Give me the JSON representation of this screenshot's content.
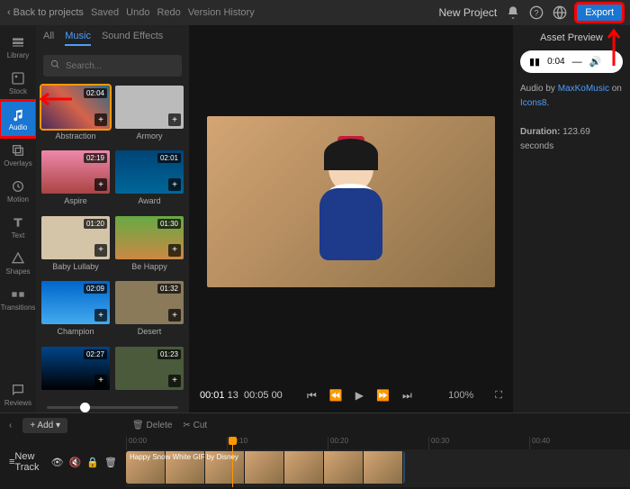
{
  "topbar": {
    "back": "Back to projects",
    "saved": "Saved",
    "undo": "Undo",
    "redo": "Redo",
    "history": "Version History",
    "title": "New Project",
    "export": "Export"
  },
  "sidebar": [
    {
      "id": "library",
      "label": "Library"
    },
    {
      "id": "stock",
      "label": "Stock"
    },
    {
      "id": "audio",
      "label": "Audio"
    },
    {
      "id": "overlays",
      "label": "Overlays"
    },
    {
      "id": "motion",
      "label": "Motion"
    },
    {
      "id": "text",
      "label": "Text"
    },
    {
      "id": "shapes",
      "label": "Shapes"
    },
    {
      "id": "transitions",
      "label": "Transitions"
    },
    {
      "id": "reviews",
      "label": "Reviews"
    }
  ],
  "tabs": {
    "all": "All",
    "music": "Music",
    "sfx": "Sound Effects"
  },
  "search": {
    "placeholder": "Search..."
  },
  "clips": [
    {
      "name": "Abstraction",
      "dur": "02:04",
      "bg": "linear-gradient(45deg,#4a2c5a,#d4634a,#2a6a8a)"
    },
    {
      "name": "Armory",
      "dur": "",
      "bg": "#bbb"
    },
    {
      "name": "Aspire",
      "dur": "02:19",
      "bg": "linear-gradient(#e8a,#a44)"
    },
    {
      "name": "Award",
      "dur": "02:01",
      "bg": "linear-gradient(#047,#069)"
    },
    {
      "name": "Baby Lullaby",
      "dur": "01:20",
      "bg": "#d4c4a8"
    },
    {
      "name": "Be Happy",
      "dur": "01:30",
      "bg": "linear-gradient(#6a4,#c84)"
    },
    {
      "name": "Champion",
      "dur": "02:09",
      "bg": "linear-gradient(#06c,#4ae)"
    },
    {
      "name": "Desert",
      "dur": "01:32",
      "bg": "#8a7a5a"
    },
    {
      "name": "",
      "dur": "02:27",
      "bg": "linear-gradient(#048,#000)"
    },
    {
      "name": "",
      "dur": "01:23",
      "bg": "#4a5a3a"
    }
  ],
  "player": {
    "cur": "00:01",
    "frames": "13",
    "total": "00:05",
    "tf": "00",
    "zoom": "100%"
  },
  "asset": {
    "title": "Asset Preview",
    "time": "0:04",
    "credit_prefix": "Audio by ",
    "author": "MaxKoMusic",
    "on": " on ",
    "site": "Icons8",
    "dur_label": "Duration: ",
    "dur": "123.69 seconds"
  },
  "timeline": {
    "add": "Add",
    "delete": "Delete",
    "cut": "Cut",
    "marks": [
      "00:00",
      "00:10",
      "00:20",
      "00:30",
      "00:40"
    ],
    "track": "New Track",
    "clip": "Happy Snow White GIF by Disney"
  }
}
